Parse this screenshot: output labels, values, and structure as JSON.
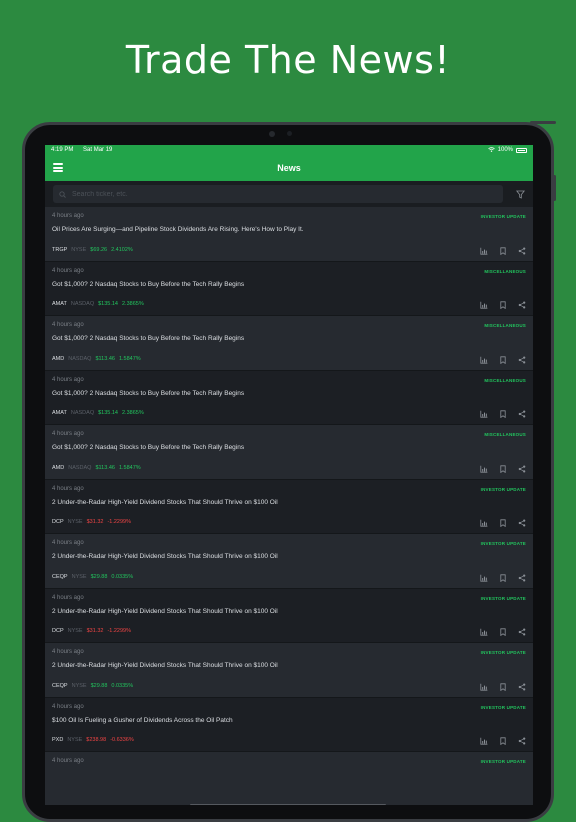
{
  "marketing": {
    "headline": "Trade The News!"
  },
  "status_bar": {
    "time": "4:19 PM",
    "date": "Sat Mar 19",
    "battery": "100%"
  },
  "nav": {
    "title": "News"
  },
  "search": {
    "placeholder": "Search ticker, etc."
  },
  "colors": {
    "background": "#2c8a40",
    "accent": "#22a44a",
    "positive": "#22c55e",
    "negative": "#ef4444"
  },
  "icons": [
    "menu-icon",
    "search-icon",
    "filter-icon",
    "chart-icon",
    "bookmark-icon",
    "share-icon",
    "wifi-icon",
    "battery-icon"
  ],
  "news": [
    {
      "time": "4 hours ago",
      "category": "INVESTOR UPDATE",
      "title": "Oil Prices Are Surging—and Pipeline Stock Dividends Are Rising. Here's How to Play It.",
      "symbol": "TRGP",
      "exchange": "NYSE",
      "price": "$69.26",
      "change": "2.4102%",
      "direction": "up"
    },
    {
      "time": "4 hours ago",
      "category": "MISCELLANEOUS",
      "title": "Got $1,000? 2 Nasdaq Stocks to Buy Before the Tech Rally Begins",
      "symbol": "AMAT",
      "exchange": "NASDAQ",
      "price": "$135.14",
      "change": "2.3865%",
      "direction": "up"
    },
    {
      "time": "4 hours ago",
      "category": "MISCELLANEOUS",
      "title": "Got $1,000? 2 Nasdaq Stocks to Buy Before the Tech Rally Begins",
      "symbol": "AMD",
      "exchange": "NASDAQ",
      "price": "$113.46",
      "change": "1.5847%",
      "direction": "up"
    },
    {
      "time": "4 hours ago",
      "category": "MISCELLANEOUS",
      "title": "Got $1,000? 2 Nasdaq Stocks to Buy Before the Tech Rally Begins",
      "symbol": "AMAT",
      "exchange": "NASDAQ",
      "price": "$135.14",
      "change": "2.3865%",
      "direction": "up"
    },
    {
      "time": "4 hours ago",
      "category": "MISCELLANEOUS",
      "title": "Got $1,000? 2 Nasdaq Stocks to Buy Before the Tech Rally Begins",
      "symbol": "AMD",
      "exchange": "NASDAQ",
      "price": "$113.46",
      "change": "1.5847%",
      "direction": "up"
    },
    {
      "time": "4 hours ago",
      "category": "INVESTOR UPDATE",
      "title": "2 Under-the-Radar High-Yield Dividend Stocks That Should Thrive on $100 Oil",
      "symbol": "DCP",
      "exchange": "NYSE",
      "price": "$31.32",
      "change": "-1.2299%",
      "direction": "down"
    },
    {
      "time": "4 hours ago",
      "category": "INVESTOR UPDATE",
      "title": "2 Under-the-Radar High-Yield Dividend Stocks That Should Thrive on $100 Oil",
      "symbol": "CEQP",
      "exchange": "NYSE",
      "price": "$29.88",
      "change": "0.0335%",
      "direction": "up"
    },
    {
      "time": "4 hours ago",
      "category": "INVESTOR UPDATE",
      "title": "2 Under-the-Radar High-Yield Dividend Stocks That Should Thrive on $100 Oil",
      "symbol": "DCP",
      "exchange": "NYSE",
      "price": "$31.32",
      "change": "-1.2299%",
      "direction": "down"
    },
    {
      "time": "4 hours ago",
      "category": "INVESTOR UPDATE",
      "title": "2 Under-the-Radar High-Yield Dividend Stocks That Should Thrive on $100 Oil",
      "symbol": "CEQP",
      "exchange": "NYSE",
      "price": "$29.88",
      "change": "0.0335%",
      "direction": "up"
    },
    {
      "time": "4 hours ago",
      "category": "INVESTOR UPDATE",
      "title": "$100 Oil Is Fueling a Gusher of Dividends Across the Oil Patch",
      "symbol": "PXD",
      "exchange": "NYSE",
      "price": "$238.98",
      "change": "-0.6336%",
      "direction": "down"
    },
    {
      "time": "4 hours ago",
      "category": "INVESTOR UPDATE",
      "title": "",
      "symbol": "",
      "exchange": "",
      "price": "",
      "change": "",
      "direction": "up"
    }
  ]
}
